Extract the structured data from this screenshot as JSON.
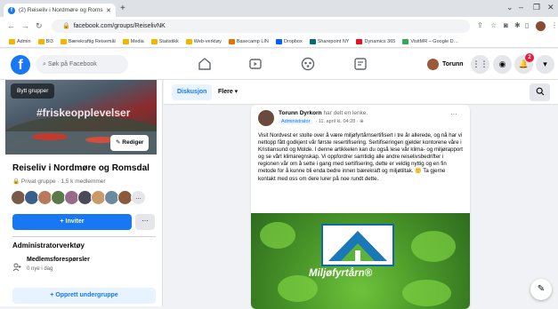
{
  "browser": {
    "tab_title": "(2) Reiseliv i Nordmøre og Roms…",
    "tab_favicon": "f",
    "new_tab_label": "+",
    "url": "facebook.com/groups/ReiselivNK",
    "bookmarks": [
      {
        "label": "Admin",
        "color": "#f4b400"
      },
      {
        "label": "BI3",
        "color": "#f4b400"
      },
      {
        "label": "Bærekraftig Reisemål",
        "color": "#f4b400"
      },
      {
        "label": "Media",
        "color": "#f4b400"
      },
      {
        "label": "Statistikk",
        "color": "#f4b400"
      },
      {
        "label": "Web-verktøy",
        "color": "#f4b400"
      },
      {
        "label": "Basecamp LIN",
        "color": "#e37400"
      },
      {
        "label": "Dropbox",
        "color": "#0061fe"
      },
      {
        "label": "Sharepoint NY",
        "color": "#036c70"
      },
      {
        "label": "Dynamics 365",
        "color": "#e81123"
      },
      {
        "label": "VisitMR – Google D…",
        "color": "#34a853"
      }
    ]
  },
  "fb_header": {
    "logo": "f",
    "search_placeholder": "Søk på Facebook",
    "user_name": "Torunn",
    "notification_count": "2"
  },
  "sidebar": {
    "switch_groups_label": "Bytt grupper",
    "cover_hashtag": "#friskeopplevelser",
    "edit_label": "Rediger",
    "group_name": "Reiseliv i Nordmøre og Romsdal",
    "group_meta": "Privat gruppe · 1,5 k medlemmer",
    "avatar_colors": [
      "#7a5a48",
      "#3a5f8a",
      "#b87a5a",
      "#5a7a4a",
      "#9a6a8a",
      "#4a4a5a",
      "#c89a6a",
      "#6a8aa0",
      "#8a5a3a"
    ],
    "avatar_more": "…",
    "invite_label": "+ Inviter",
    "more_label": "···",
    "admin_title": "Administratorverktøy",
    "requests_title": "Medlemsforespørsler",
    "requests_sub": "0 nye i dag",
    "create_subgroup_label": "+ Opprett undergruppe"
  },
  "content_tabs": {
    "discussion": "Diskusjon",
    "more": "Flere ▾"
  },
  "post": {
    "author": "Torunn Dyrkorn",
    "author_suffix": " har delt en lenke.",
    "role": "Administrator",
    "timestamp": "· 11. april kl. 04:28 · ⊕",
    "more": "···",
    "body": "Visit Nordvest er stolte over å være miljøfyrtårnsertifisert i tre år allerede, og nå har vi nettopp fått godkjent vår første resertifisering. Sertifiseringen gjelder kontorene våre i Kristiansund og Molde. I denne artikkelen kan du også lese vår klima- og miljørapport og se vårt klimaregnskap. Vi oppfordrer samtidig alle andre reiselivsbedrifter i regionen vår om å sette i gang med sertifisering, dette er veldig nyttig og en fin metode for å kunne bli enda bedre innen bærekraft og miljøtiltak. 🙂 Ta gjerne kontakt med oss om dere lurer på noe rundt dette.",
    "image_logo_text": "Miljøfyrtårn®"
  }
}
